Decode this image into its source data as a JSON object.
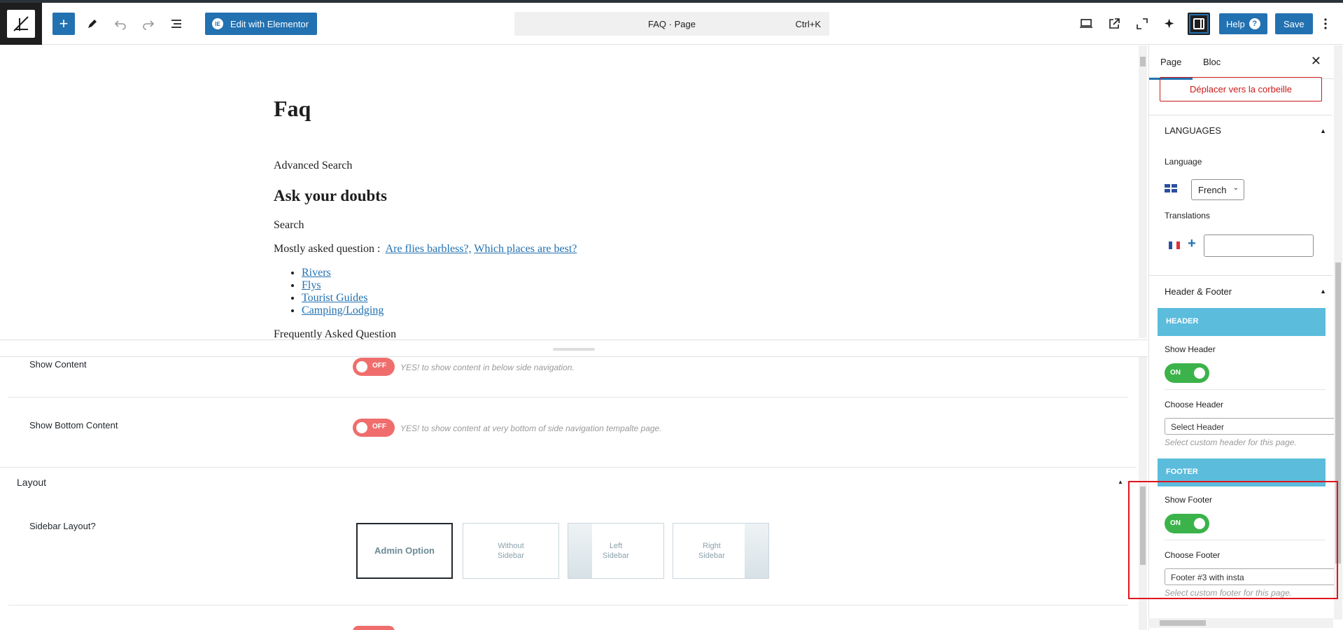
{
  "toolbar": {
    "edit_elementor_label": "Edit with Elementor",
    "elementor_badge": "IE",
    "command_title": "FAQ · Page",
    "command_shortcut": "Ctrl+K",
    "help_label": "Help",
    "help_badge": "?",
    "save_label": "Save",
    "icons": [
      "plus-icon",
      "pen-icon",
      "undo-icon",
      "redo-icon",
      "list-view-icon",
      "desktop-icon",
      "external-link-icon",
      "fullscreen-icon",
      "ai-sparkle-icon",
      "sidebar-icon",
      "more-icon"
    ]
  },
  "canvas": {
    "title": "Faq",
    "advanced_search": "Advanced Search",
    "heading": "Ask your doubts",
    "search": "Search",
    "mostly_asked_prefix": "Mostly asked question :",
    "mostly_asked_links": [
      "Are flies barbless?,",
      "Which places are best?"
    ],
    "list_items": [
      "Rivers",
      "Flys",
      "Tourist Guides",
      "Camping/Lodging"
    ],
    "faq_heading": "Frequently Asked Question"
  },
  "meta": {
    "show_content": {
      "label": "Show Content",
      "toggle": "OFF",
      "desc": "YES! to show content in below side navigation."
    },
    "show_bottom_content": {
      "label": "Show Bottom Content",
      "toggle": "OFF",
      "desc": "YES! to show content at very bottom of side navigation tempalte page."
    },
    "layout_title": "Layout",
    "sidebar_layout_label": "Sidebar Layout?",
    "layout_options": [
      "Admin Option",
      "Without Sidebar",
      "Left Sidebar",
      "Right Sidebar"
    ],
    "selected_layout": "Admin Option"
  },
  "panel": {
    "tabs": [
      "Page",
      "Bloc"
    ],
    "active_tab": "Page",
    "trash_label": "Déplacer vers la corbeille",
    "languages_title": "LANGUAGES",
    "language_label": "Language",
    "language_value": "French",
    "translations_label": "Translations",
    "header_footer_title": "Header & Footer",
    "header_bar": "HEADER",
    "show_header_label": "Show Header",
    "show_header_toggle": "ON",
    "choose_header_label": "Choose Header",
    "choose_header_value": "Select Header",
    "choose_header_help": "Select custom header for this page.",
    "footer_bar": "FOOTER",
    "show_footer_label": "Show Footer",
    "show_footer_toggle": "ON",
    "choose_footer_label": "Choose Footer",
    "choose_footer_value": "Footer #3 with insta",
    "choose_footer_help": "Select custom footer for this page."
  },
  "colors": {
    "accent": "#2271b1",
    "toggle_on": "#3bb34a",
    "toggle_off": "#f06d6d",
    "section_bar": "#5bbcdc",
    "highlight": "#e0141e",
    "danger": "#cc1818"
  }
}
